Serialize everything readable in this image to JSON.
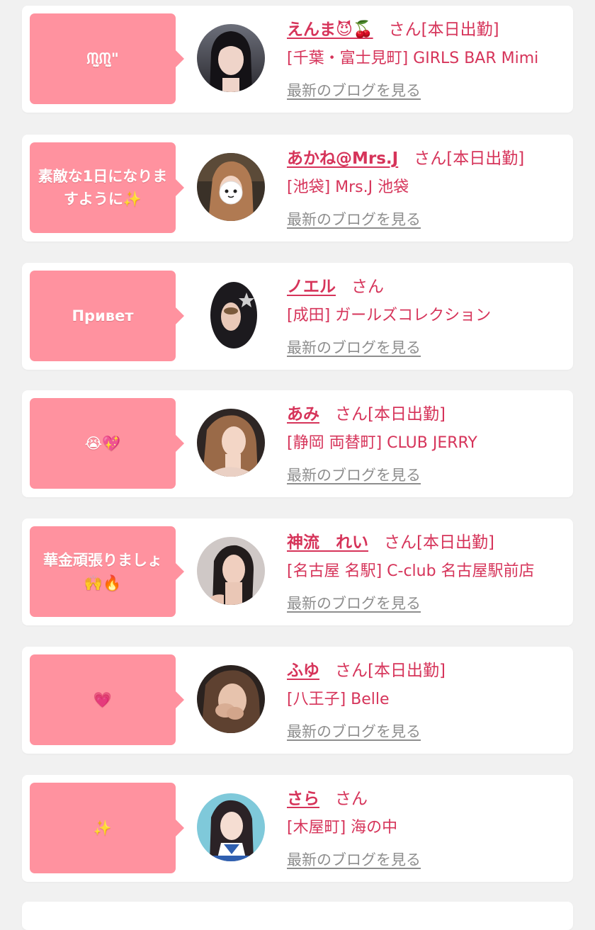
{
  "colors": {
    "background": "#f1f1f1",
    "card": "#ffffff",
    "bubble": "#ff929f",
    "name": "#d6345a",
    "link": "#8e8e8e"
  },
  "entries": [
    {
      "message": "ᙏ̤̫ᙏ̤̫\"",
      "name": "えんま😈🍒",
      "suffix": "さん[本日出勤]",
      "location": "[千葉・富士見町] GIRLS BAR Mimi",
      "blog_link": "最新のブログを見る",
      "avatar_icon": "avatar-photo"
    },
    {
      "message": "素敵な1日になりますように✨",
      "name": "あかね@Mrs.J",
      "suffix": "さん[本日出勤]",
      "location": "[池袋] Mrs.J 池袋",
      "blog_link": "最新のブログを見る",
      "avatar_icon": "avatar-photo"
    },
    {
      "message": "Привет",
      "name": "ノエル",
      "suffix": "さん",
      "location": "[成田] ガールズコレクション",
      "blog_link": "最新のブログを見る",
      "avatar_icon": "avatar-photo"
    },
    {
      "message": "😭💖",
      "name": "あみ",
      "suffix": "さん[本日出勤]",
      "location": "[静岡 両替町] CLUB JERRY",
      "blog_link": "最新のブログを見る",
      "avatar_icon": "avatar-photo"
    },
    {
      "message": "華金頑張りましょ🙌🔥",
      "name": "神流　れい",
      "suffix": "さん[本日出勤]",
      "location": "[名古屋 名駅] C-club 名古屋駅前店",
      "blog_link": "最新のブログを見る",
      "avatar_icon": "avatar-photo"
    },
    {
      "message": "💗",
      "name": "ふゆ",
      "suffix": "さん[本日出勤]",
      "location": "[八王子] Belle",
      "blog_link": "最新のブログを見る",
      "avatar_icon": "avatar-photo"
    },
    {
      "message": "✨",
      "name": "さら",
      "suffix": "さん",
      "location": "[木屋町] 海の中",
      "blog_link": "最新のブログを見る",
      "avatar_icon": "avatar-photo"
    }
  ]
}
